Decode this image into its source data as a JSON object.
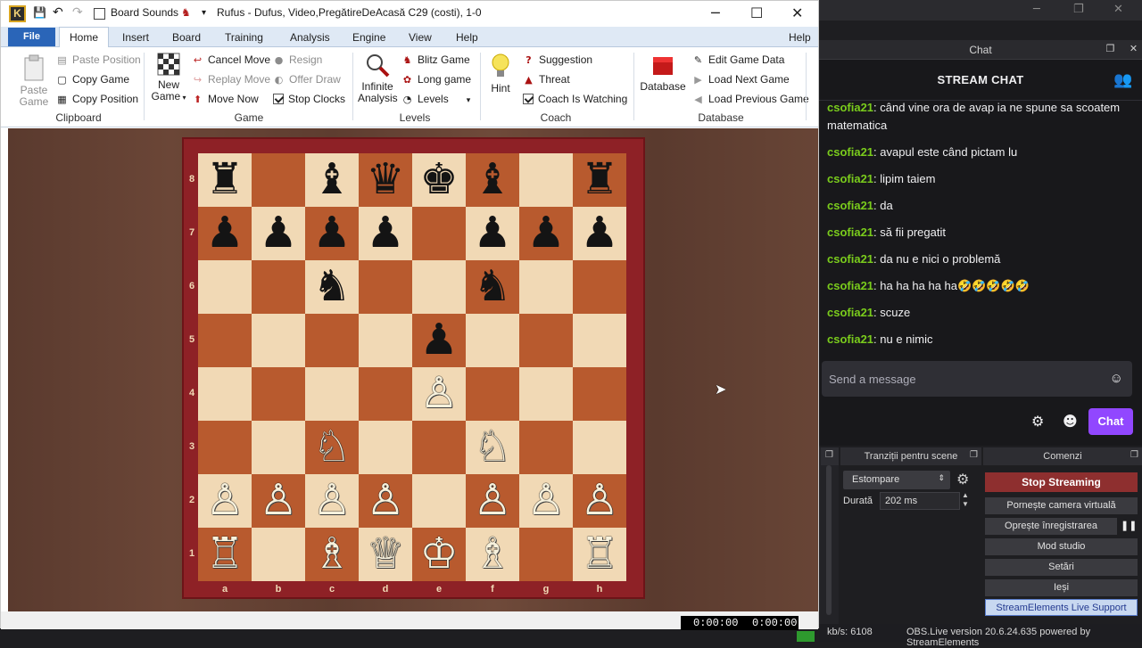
{
  "chess": {
    "title": "Rufus - Dufus, Video,PregătireDeAcasă  C29  (costi), 1-0",
    "qat_board_sounds": "Board Sounds",
    "menu": [
      "File",
      "Home",
      "Insert",
      "Board",
      "Training",
      "Analysis",
      "Engine",
      "View",
      "Help"
    ],
    "help_right": "Help",
    "ribbon": {
      "paste_game": "Paste Game",
      "paste_position": "Paste Position",
      "copy_game": "Copy Game",
      "copy_position": "Copy Position",
      "clipboard": "Clipboard",
      "new_game": "New Game",
      "cancel_move": "Cancel Move",
      "replay_move": "Replay Move",
      "move_now": "Move Now",
      "resign": "Resign",
      "offer_draw": "Offer Draw",
      "stop_clocks": "Stop Clocks",
      "game": "Game",
      "infinite_analysis": "Infinite Analysis",
      "blitz_game": "Blitz Game",
      "long_game": "Long game",
      "levels_btn": "Levels",
      "levels": "Levels",
      "hint": "Hint",
      "suggestion": "Suggestion",
      "threat": "Threat",
      "coach_watching": "Coach Is Watching",
      "coach": "Coach",
      "database_btn": "Database",
      "edit_game_data": "Edit Game Data",
      "load_next": "Load Next Game",
      "load_prev": "Load Previous Game",
      "database": "Database"
    },
    "files": [
      "a",
      "b",
      "c",
      "d",
      "e",
      "f",
      "g",
      "h"
    ],
    "ranks": [
      "8",
      "7",
      "6",
      "5",
      "4",
      "3",
      "2",
      "1"
    ],
    "position": [
      [
        "♜",
        "",
        "♝",
        "♛",
        "♚",
        "♝",
        "",
        "♜"
      ],
      [
        "♟",
        "♟",
        "♟",
        "♟",
        "",
        "♟",
        "♟",
        "♟"
      ],
      [
        "",
        "",
        "♞",
        "",
        "",
        "♞",
        "",
        ""
      ],
      [
        "",
        "",
        "",
        "",
        "♟",
        "",
        "",
        ""
      ],
      [
        "",
        "",
        "",
        "",
        "♙",
        "",
        "",
        ""
      ],
      [
        "",
        "",
        "♘",
        "",
        "",
        "♘",
        "",
        ""
      ],
      [
        "♙",
        "♙",
        "♙",
        "♙",
        "",
        "♙",
        "♙",
        "♙"
      ],
      [
        "♖",
        "",
        "♗",
        "♕",
        "♔",
        "♗",
        "",
        "♖"
      ]
    ],
    "clock_white": "0:00:00",
    "clock_black": "0:00:00"
  },
  "obs": {
    "chat_dock_title": "Chat",
    "stream_chat": "STREAM CHAT",
    "messages": [
      {
        "user": "csofia21",
        "text": ": când vine ora de avap ia ne spune sa scoatem matematica"
      },
      {
        "user": "csofia21",
        "text": ": avapul este când pictam lu"
      },
      {
        "user": "csofia21",
        "text": ": lipim taiem"
      },
      {
        "user": "csofia21",
        "text": ": da"
      },
      {
        "user": "csofia21",
        "text": ": să fii pregatit"
      },
      {
        "user": "csofia21",
        "text": ": da nu e nici o problemă"
      },
      {
        "user": "csofia21",
        "text": ": ha ha ha ha ha🤣🤣🤣🤣🤣"
      },
      {
        "user": "csofia21",
        "text": ": scuze"
      },
      {
        "user": "csofia21",
        "text": ": nu e nimic"
      }
    ],
    "send_placeholder": "Send a message",
    "chat_button": "Chat",
    "transitions_title": "Tranziții pentru scene",
    "controls_title": "Comenzi",
    "transition": "Estompare",
    "duration_label": "Durată",
    "duration_value": "202 ms",
    "controls": [
      "Stop Streaming",
      "Pornește camera virtuală",
      "Oprește înregistrarea",
      "Mod studio",
      "Setări",
      "Ieși",
      "StreamElements Live Support"
    ],
    "status_kbps": "kb/s: 6108",
    "status_version": "OBS.Live version 20.6.24.635 powered by StreamElements"
  },
  "colors": {
    "accent_purple": "#9147ff",
    "username_green": "#7acc1c",
    "stop_red": "#8e2f2f"
  }
}
